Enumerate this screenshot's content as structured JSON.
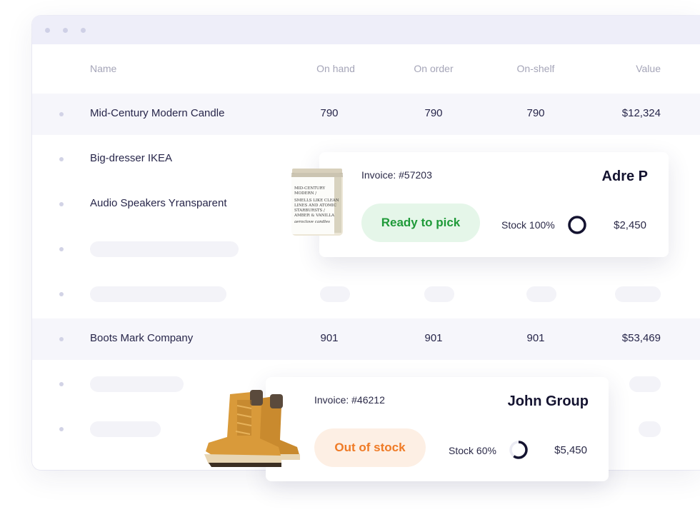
{
  "table": {
    "headers": {
      "name": "Name",
      "on_hand": "On hand",
      "on_order": "On order",
      "on_shelf": "On-shelf",
      "value": "Value"
    },
    "rows": [
      {
        "name": "Mid-Century Modern Candle",
        "on_hand": "790",
        "on_order": "790",
        "on_shelf": "790",
        "value": "$12,324"
      },
      {
        "name": "Big-dresser IKEA"
      },
      {
        "name": "Audio Speakers Yransparent"
      },
      {
        "name": "Boots Mark Company",
        "on_hand": "901",
        "on_order": "901",
        "on_shelf": "901",
        "value": "$53,469"
      }
    ]
  },
  "cards": [
    {
      "invoice": "Invoice: #57203",
      "client": "Adre P",
      "status": "Ready to pick",
      "stock_label": "Stock 100%",
      "stock_fraction": 1.0,
      "price": "$2,450",
      "product_icon": "candle-jar",
      "jar_label": {
        "line1": "MID-CENTURY",
        "line2": "MODERN /",
        "line3": "SMELLS LIKE CLEAN",
        "line4": "LINES AND ATOMIC",
        "line5": "STARBURSTS /",
        "line6": "AMBER & VANILLA",
        "line7": "aeroclove candles"
      }
    },
    {
      "invoice": "Invoice: #46212",
      "client": "John Group",
      "status": "Out of stock",
      "stock_label": "Stock 60%",
      "stock_fraction": 0.6,
      "price": "$5,450",
      "product_icon": "boots"
    }
  ],
  "colors": {
    "ready_bg": "#e5f6e9",
    "ready_text": "#1f9a39",
    "out_bg": "#fdefe4",
    "out_text": "#ef7a25",
    "ring": "#141330"
  }
}
